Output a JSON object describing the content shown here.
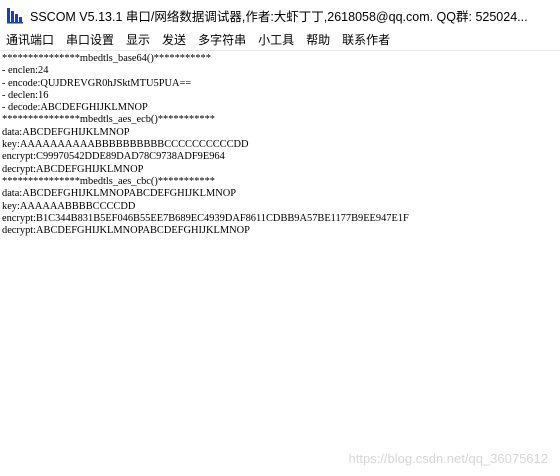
{
  "window": {
    "title": "SSCOM V5.13.1 串口/网络数据调试器,作者:大虾丁丁,2618058@qq.com. QQ群: 525024..."
  },
  "icons": {
    "app": "sscom-app-icon"
  },
  "menu": {
    "items": [
      "通讯端口",
      "串口设置",
      "显示",
      "发送",
      "多字符串",
      "小工具",
      "帮助",
      "联系作者"
    ]
  },
  "terminal": {
    "lines": [
      "***************mbedtls_base64()***********",
      "- enclen:24",
      "- encode:QUJDREVGR0hJSktMTU5PUA==",
      "- declen:16",
      "- decode:ABCDEFGHIJKLMNOP",
      "***************mbedtls_aes_ecb()***********",
      "data:ABCDEFGHIJKLMNOP",
      "key:AAAAAAAAAABBBBBBBBBBCCCCCCCCCCDD",
      "encrypt:C99970542DDE89DAD78C9738ADF9E964",
      "decrypt:ABCDEFGHIJKLMNOP",
      "***************mbedtls_aes_cbc()***********",
      "data:ABCDEFGHIJKLMNOPABCDEFGHIJKLMNOP",
      "key:AAAAAABBBBCCCCDD",
      "encrypt:B1C344B831B5EF046B55EE7B689EC4939DAF8611CDBB9A57BE1177B9EE947E1F",
      "decrypt:ABCDEFGHIJKLMNOPABCDEFGHIJKLMNOP"
    ]
  },
  "watermark": {
    "text": "https://blog.csdn.net/qq_36075612"
  },
  "colors": {
    "background": "#ffffff",
    "text": "#000000",
    "watermark": "#d6d6d6",
    "icon_blue": "#1f3fae"
  }
}
